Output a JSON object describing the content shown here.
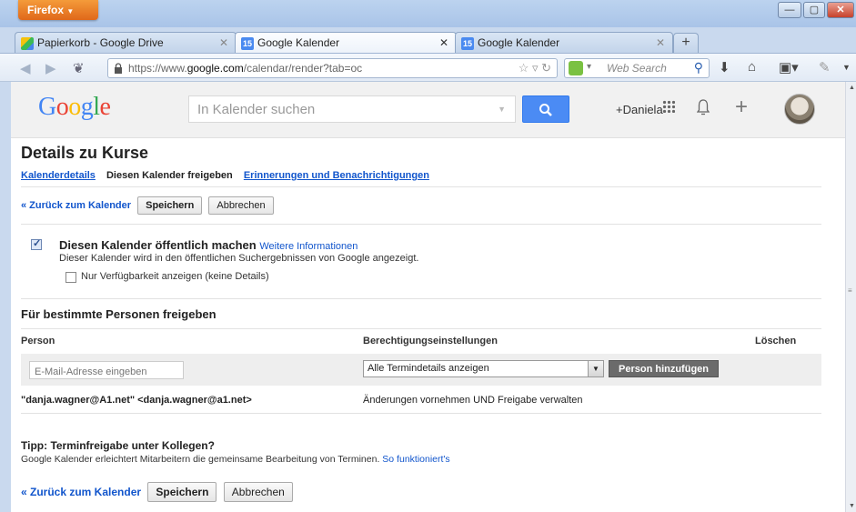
{
  "browser": {
    "app_button": "Firefox",
    "tabs": [
      {
        "label": "Papierkorb - Google Drive",
        "icon": "google-drive-icon"
      },
      {
        "label": "Google Kalender",
        "icon": "google-calendar-icon",
        "favicon_text": "15"
      },
      {
        "label": "Google Kalender",
        "icon": "google-calendar-icon",
        "favicon_text": "15"
      }
    ],
    "url_prefix": "https://www.",
    "url_host": "google.com",
    "url_path": "/calendar/render?tab=oc",
    "search_placeholder": "Web Search"
  },
  "header": {
    "logo": "Google",
    "search_placeholder": "In Kalender suchen",
    "user_name": "+Daniela"
  },
  "page": {
    "title": "Details zu Kurse",
    "subtabs": [
      "Kalenderdetails",
      "Diesen Kalender freigeben",
      "Erinnerungen und Benachrichtigungen"
    ],
    "back_link": "« Zurück zum Kalender",
    "save_label": "Speichern",
    "cancel_label": "Abbrechen",
    "public": {
      "checked": true,
      "title": "Diesen Kalender öffentlich machen",
      "more_info": "Weitere Informationen",
      "description": "Dieser Kalender wird in den öffentlichen Suchergebnissen von Google angezeigt.",
      "availability_label": "Nur Verfügbarkeit anzeigen (keine Details)"
    },
    "share": {
      "heading": "Für bestimmte Personen freigeben",
      "col_person": "Person",
      "col_permissions": "Berechtigungseinstellungen",
      "col_delete": "Löschen",
      "email_placeholder": "E-Mail-Adresse eingeben",
      "permission_selected": "Alle Termindetails anzeigen",
      "add_person_label": "Person hinzufügen",
      "entries": [
        {
          "person": "\"danja.wagner@A1.net\" <danja.wagner@a1.net>",
          "permission": "Änderungen vornehmen UND Freigabe verwalten"
        }
      ]
    },
    "tip": {
      "title": "Tipp: Terminfreigabe unter Kollegen?",
      "text": "Google Kalender erleichtert Mitarbeitern die gemeinsame Bearbeitung von Terminen.",
      "link": "So funktioniert's"
    }
  },
  "colors": {
    "link": "#1155cc",
    "search_button": "#4b8bf4",
    "add_person_button": "#6b6b6b",
    "firefox_orange": "#e0681a"
  }
}
